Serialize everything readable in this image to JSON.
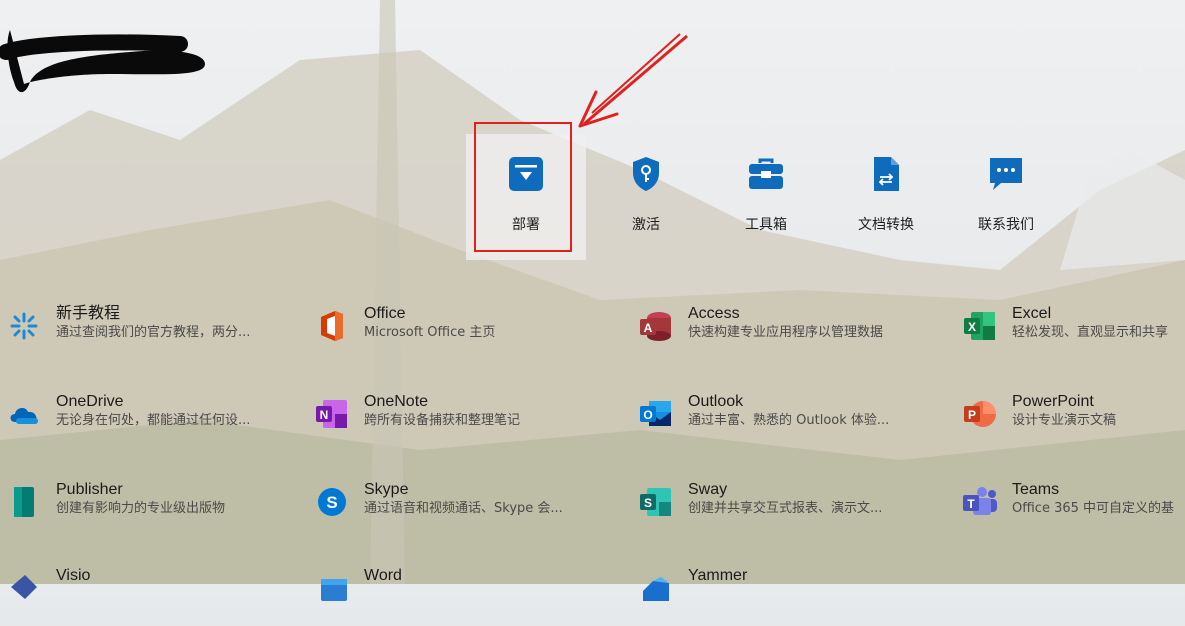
{
  "colors": {
    "accent": "#0f6cbd",
    "annotation_red": "#e0211d"
  },
  "top_tiles": [
    {
      "label": "部署",
      "icon": "download-box-icon",
      "selected": true
    },
    {
      "label": "激活",
      "icon": "shield-key-icon",
      "selected": false
    },
    {
      "label": "工具箱",
      "icon": "toolbox-icon",
      "selected": false
    },
    {
      "label": "文档转换",
      "icon": "document-convert-icon",
      "selected": false
    },
    {
      "label": "联系我们",
      "icon": "chat-bubble-icon",
      "selected": false
    }
  ],
  "apps": [
    {
      "name": "新手教程",
      "desc": "通过查阅我们的官方教程，两分...",
      "icon": "tutorial-icon"
    },
    {
      "name": "Office",
      "desc": "Microsoft Office 主页",
      "icon": "office-icon"
    },
    {
      "name": "Access",
      "desc": "快速构建专业应用程序以管理数据",
      "icon": "access-icon"
    },
    {
      "name": "Excel",
      "desc": "轻松发现、直观显示和共享",
      "icon": "excel-icon"
    },
    {
      "name": "OneDrive",
      "desc": "无论身在何处，都能通过任何设...",
      "icon": "onedrive-icon"
    },
    {
      "name": "OneNote",
      "desc": "跨所有设备捕获和整理笔记",
      "icon": "onenote-icon"
    },
    {
      "name": "Outlook",
      "desc": "通过丰富、熟悉的 Outlook 体验...",
      "icon": "outlook-icon"
    },
    {
      "name": "PowerPoint",
      "desc": "设计专业演示文稿",
      "icon": "powerpoint-icon"
    },
    {
      "name": "Publisher",
      "desc": "创建有影响力的专业级出版物",
      "icon": "publisher-icon"
    },
    {
      "name": "Skype",
      "desc": "通过语音和视频通话、Skype 会...",
      "icon": "skype-icon"
    },
    {
      "name": "Sway",
      "desc": "创建并共享交互式报表、演示文...",
      "icon": "sway-icon"
    },
    {
      "name": "Teams",
      "desc": "Office 365 中可自定义的基",
      "icon": "teams-icon"
    },
    {
      "name": "Visio",
      "desc": "",
      "icon": "visio-icon"
    },
    {
      "name": "Word",
      "desc": "",
      "icon": "word-icon"
    },
    {
      "name": "Yammer",
      "desc": "",
      "icon": "yammer-icon"
    }
  ]
}
